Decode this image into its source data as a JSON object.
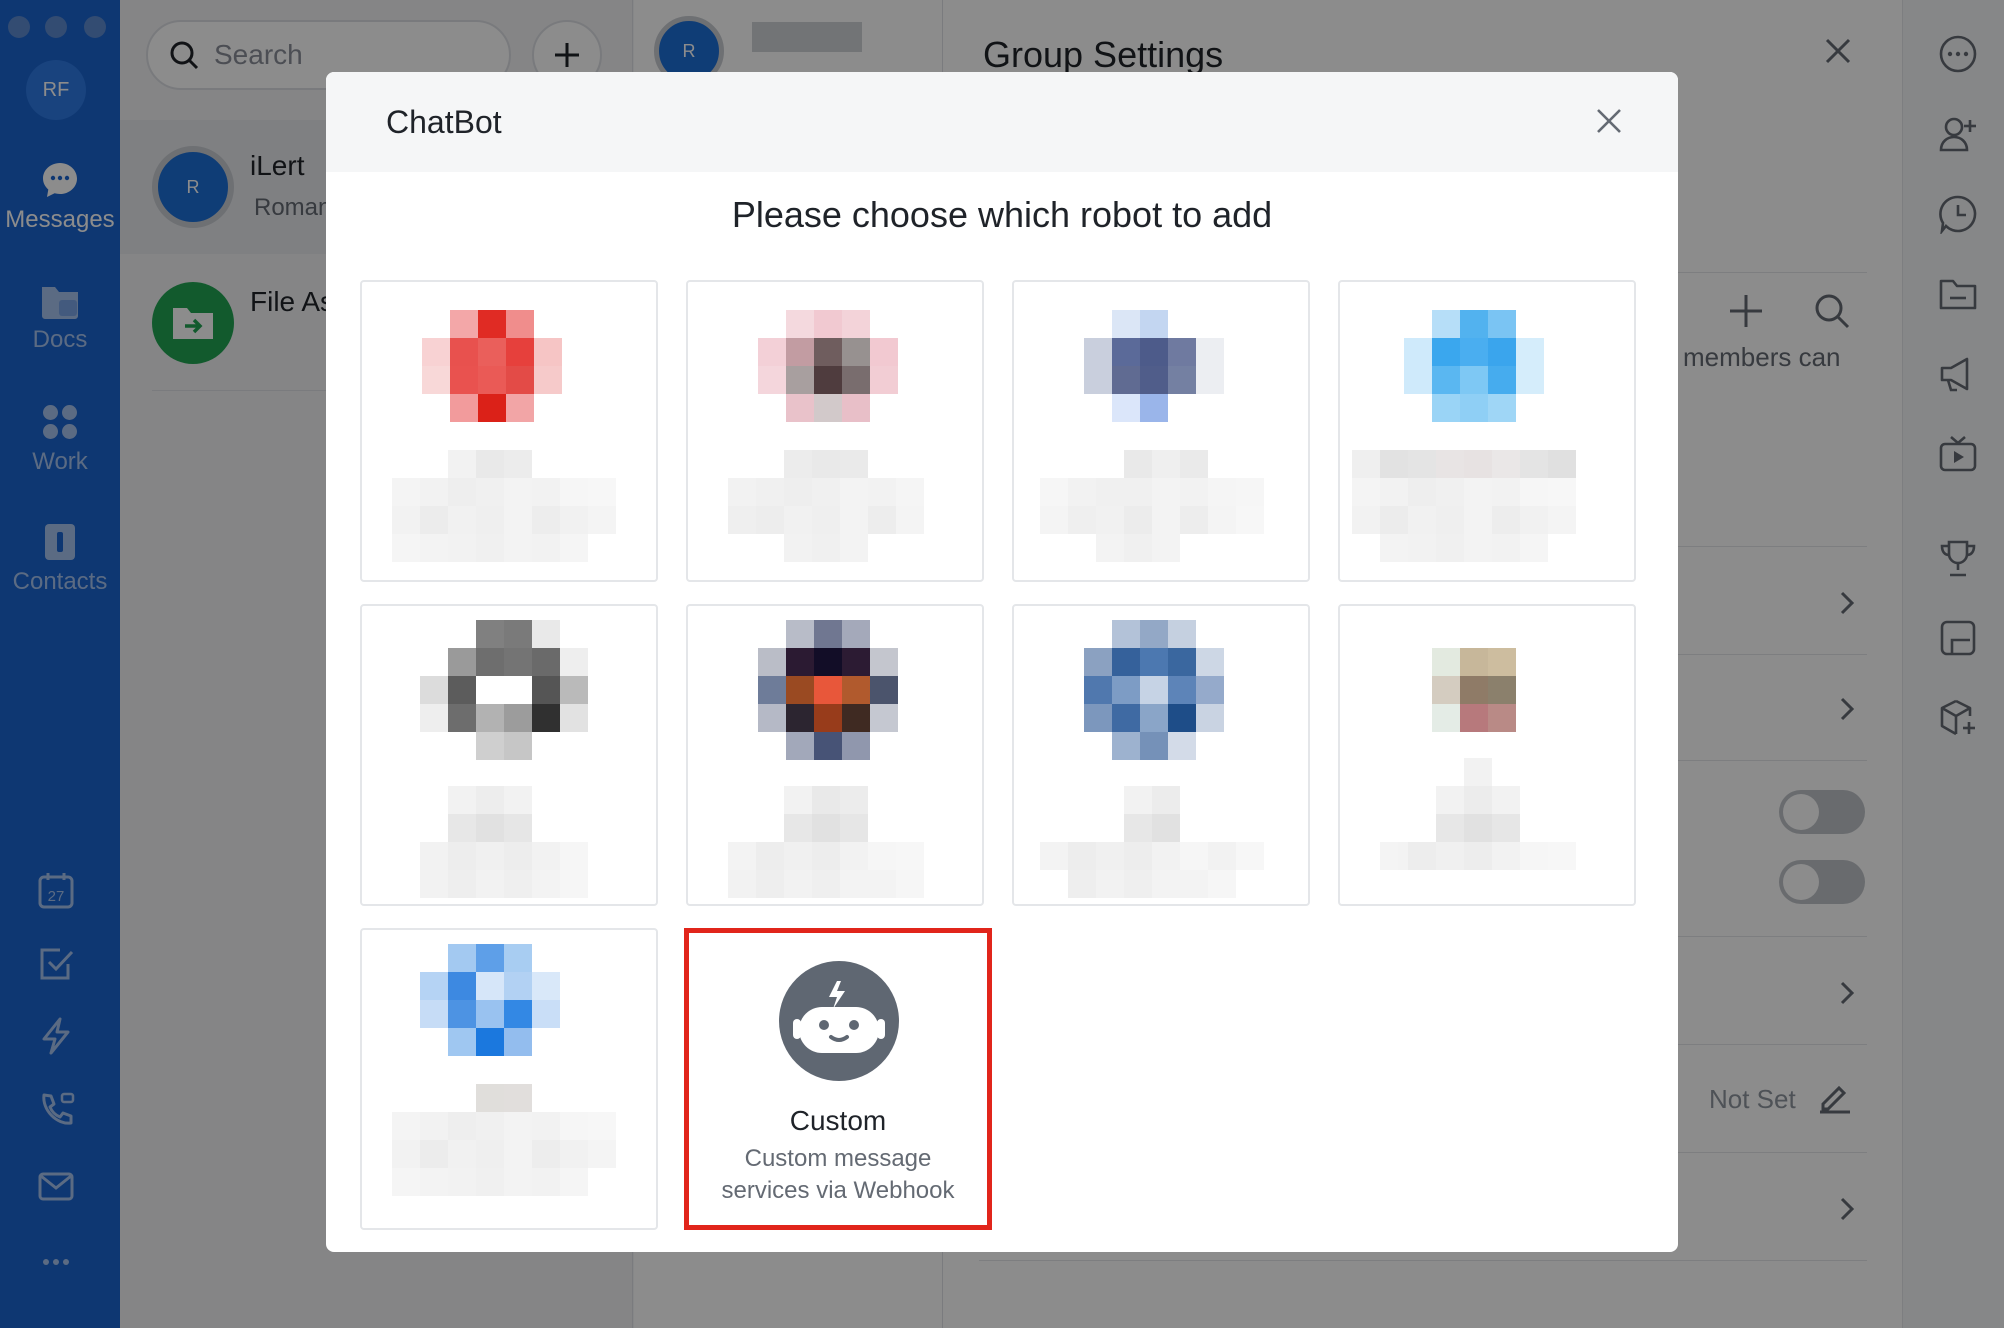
{
  "sidebar": {
    "avatar_initials": "RF",
    "nav": [
      {
        "label": "Messages",
        "icon": "chat-bubble-icon",
        "active": true
      },
      {
        "label": "Docs",
        "icon": "folder-icon",
        "active": false
      },
      {
        "label": "Work",
        "icon": "apps-grid-icon",
        "active": false
      },
      {
        "label": "Contacts",
        "icon": "contacts-book-icon",
        "active": false
      }
    ],
    "bottom_icons": [
      "calendar-icon",
      "task-check-icon",
      "lightning-icon",
      "phone-icon",
      "mail-icon",
      "more-icon"
    ],
    "calendar_day": "27"
  },
  "list": {
    "search_placeholder": "Search",
    "conversations": [
      {
        "name": "iLert",
        "subtitle": "Roman",
        "avatar_initial": "R"
      },
      {
        "name": "File As",
        "subtitle": ""
      }
    ]
  },
  "chat": {
    "avatar_initial": "R"
  },
  "settings": {
    "title": "Group Settings",
    "members_text": "members can",
    "not_set": "Not Set"
  },
  "rail": {
    "icons": [
      "more-options-icon",
      "add-member-icon",
      "history-icon",
      "folder-icon",
      "announcement-icon",
      "video-icon",
      "trophy-icon",
      "notes-icon",
      "add-app-icon"
    ]
  },
  "modal": {
    "title": "ChatBot",
    "subtitle": "Please choose which robot to add",
    "custom": {
      "title": "Custom",
      "description_line1": "Custom message",
      "description_line2": "services via Webhook"
    }
  },
  "colors": {
    "sidebar_blue": "#1a64cf",
    "highlight_red": "#e1251b",
    "robot_gray": "#5f6772"
  }
}
